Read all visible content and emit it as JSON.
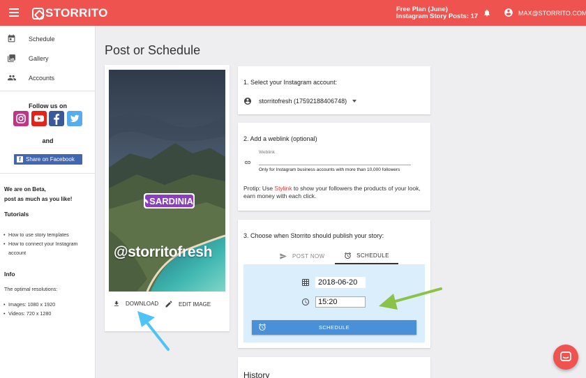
{
  "app": {
    "brand": "STORRITO"
  },
  "header": {
    "plan_line1": "Free Plan (June)",
    "plan_line2": "Instagram Story Posts: 17",
    "account_email": "MAX@STORRITO.COM"
  },
  "sidebar": {
    "nav": [
      {
        "label": "Schedule",
        "icon": "calendar-icon"
      },
      {
        "label": "Gallery",
        "icon": "gallery-icon"
      },
      {
        "label": "Accounts",
        "icon": "people-icon"
      }
    ],
    "follow_us": "Follow us on",
    "and_text": "and",
    "share_facebook": "Share on Facebook",
    "beta_line1": "We are on Beta,",
    "beta_line2": "post as much as you like!",
    "tutorials_title": "Tutorials",
    "tutorials": [
      "How to use story templates",
      "How to connect your Instagram account"
    ],
    "info_title": "Info",
    "optimal_text": "The optimal resolutions:",
    "resolutions": [
      "Images: 1080 x 1920",
      "Videos: 720 x 1280"
    ]
  },
  "main": {
    "page_title": "Post or Schedule",
    "story": {
      "location_tag": "SARDINIA",
      "handle": "@storritofresh"
    },
    "actions": {
      "download": "DOWNLOAD",
      "edit_image": "EDIT IMAGE"
    },
    "step1": {
      "title": "1. Select your Instagram account:",
      "selected_account": "storritofresh (17592188406748)"
    },
    "step2": {
      "title": "2. Add a weblink (optional)",
      "weblink_label": "Weblink",
      "weblink_value": "",
      "help": "Only for Instagram business accounts with more than 10,000 followers",
      "protip_prefix": "Protip: Use ",
      "protip_link": "Stylink",
      "protip_suffix": " to show your followers the products of your look, earn money with each click."
    },
    "step3": {
      "title": "3. Choose when Storrito should publish your story:",
      "tab_post_now": "POST NOW",
      "tab_schedule": "SCHEDULE",
      "active_tab": "SCHEDULE",
      "date": "2018-06-20",
      "time": "15:20",
      "schedule_button": "SCHEDULE"
    },
    "history_title": "History"
  },
  "colors": {
    "brand_red": "#ef5350",
    "schedule_blue": "#4a90d9",
    "panel_blue": "#dbeefc",
    "arrow_cyan": "#4fc3f7",
    "arrow_green": "#8bc34a"
  }
}
